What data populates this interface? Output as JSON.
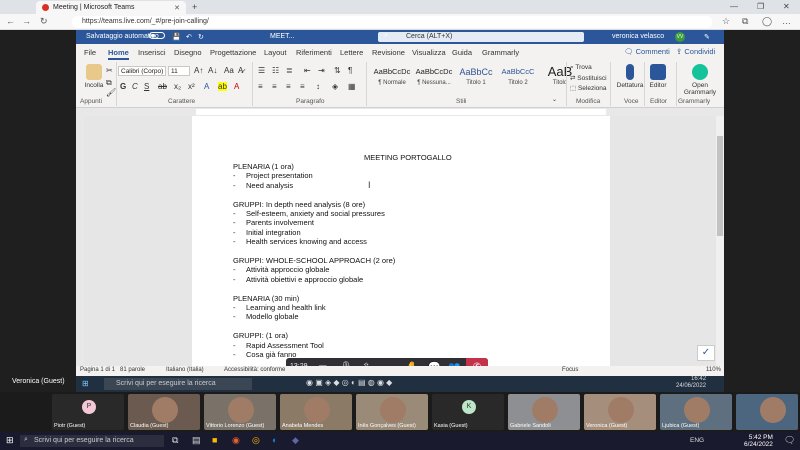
{
  "browser": {
    "tab_title": "Meeting | Microsoft Teams",
    "url": "https://teams.live.com/_#/pre-join-calling/",
    "new_tab": "+"
  },
  "word": {
    "autosave_label": "Salvataggio automatico",
    "doc_title": "MEET...",
    "search_placeholder": "Cerca (ALT+X)",
    "user_name": "veronica velasco",
    "user_initials": "VV",
    "menu_tabs": [
      "File",
      "Home",
      "Inserisci",
      "Disegno",
      "Progettazione",
      "Layout",
      "Riferimenti",
      "Lettere",
      "Revisione",
      "Visualizza",
      "Guida",
      "Grammarly"
    ],
    "active_tab": "Home",
    "comments_label": "Commenti",
    "share_label": "Condividi"
  },
  "ribbon": {
    "paste_label": "Incolla",
    "clipboard_group": "Appunti",
    "font_name": "Calibri (Corpo)",
    "font_size": "11",
    "font_group": "Carattere",
    "paragraph_group": "Paragrafo",
    "styles": [
      {
        "sample": "AaBbCcDc",
        "name": "¶ Normale"
      },
      {
        "sample": "AaBbCcDc",
        "name": "¶ Nessuna..."
      },
      {
        "sample": "AaBbCc",
        "name": "Titolo 1"
      },
      {
        "sample": "AaBbCcC",
        "name": "Titolo 2"
      },
      {
        "sample": "AaB",
        "name": "Titolo"
      }
    ],
    "styles_group": "Stili",
    "find_label": "Trova",
    "replace_label": "Sostituisci",
    "select_label": "Seleziona",
    "edit_group": "Modifica",
    "dictate_label": "Dettatura",
    "voice_group": "Voce",
    "editor_label": "Editor",
    "editor_group": "Editor",
    "grammarly_label": "Open Grammarly",
    "grammarly_group": "Grammarly"
  },
  "document": {
    "title": "MEETING PORTOGALLO",
    "lines": [
      {
        "text": "PLENARIA (1 ora)",
        "bullet": false
      },
      {
        "text": "Project presentation",
        "bullet": true
      },
      {
        "text": "Need analysis",
        "bullet": true
      },
      {
        "text": "",
        "bullet": false
      },
      {
        "text": "GRUPPI: In depth need analysis (8 ore)",
        "bullet": false
      },
      {
        "text": "Self-esteem, anxiety and social pressures",
        "bullet": true
      },
      {
        "text": "Parents involvement",
        "bullet": true
      },
      {
        "text": "Initial integration",
        "bullet": true
      },
      {
        "text": "Health services knowing and access",
        "bullet": true
      },
      {
        "text": "",
        "bullet": false
      },
      {
        "text": "GRUPPI: WHOLE-SCHOOL APPROACH (2 ore)",
        "bullet": false
      },
      {
        "text": "Attività approccio globale",
        "bullet": true
      },
      {
        "text": "Attività obiettivi e approccio globale",
        "bullet": true
      },
      {
        "text": "",
        "bullet": false
      },
      {
        "text": "PLENARIA (30 min)",
        "bullet": false
      },
      {
        "text": "Learning and health link",
        "bullet": true
      },
      {
        "text": "Modello globale",
        "bullet": true
      },
      {
        "text": "",
        "bullet": false
      },
      {
        "text": "GRUPPI: (1 ora)",
        "bullet": false
      },
      {
        "text": "Rapid Assessment Tool",
        "bullet": true
      },
      {
        "text": "Cosa già fanno",
        "bullet": true
      }
    ]
  },
  "status": {
    "page": "Pagina 1 di 1",
    "words": "81 parole",
    "language": "Italiano (Italia)",
    "accessibility": "Accessibilità: conforme",
    "focus": "Focus",
    "zoom": "110%"
  },
  "teams": {
    "timer": "13:29"
  },
  "inner_taskbar": {
    "search": "Scrivi qui per eseguire la ricerca",
    "time": "16:42",
    "date": "24/06/2022"
  },
  "sharer_label": "Veronica (Guest)",
  "participants": [
    {
      "name": "Piotr (Guest)",
      "initial": "P",
      "type": "initial",
      "color": "#f4c7d6"
    },
    {
      "name": "Claudia (Guest)",
      "initial": "",
      "type": "video",
      "color": "#6a5a50"
    },
    {
      "name": "Vittorio Lorenzo (Guest)",
      "initial": "",
      "type": "video",
      "color": "#7a7268"
    },
    {
      "name": "Anabela Mendes",
      "initial": "",
      "type": "video",
      "color": "#8a7a66"
    },
    {
      "name": "Inês Gonçalves (Guest)",
      "initial": "",
      "type": "video",
      "color": "#9a8a78"
    },
    {
      "name": "Kasia (Guest)",
      "initial": "K",
      "type": "initial",
      "color": "#bde5c8"
    },
    {
      "name": "Gabriele Sandoli",
      "initial": "",
      "type": "video",
      "color": "#8d8f92"
    },
    {
      "name": "Veronica (Guest)",
      "initial": "",
      "type": "video",
      "color": "#a68e7c"
    },
    {
      "name": "Ljubica (Guest)",
      "initial": "",
      "type": "video",
      "color": "#5e6f7f"
    },
    {
      "name": "",
      "initial": "",
      "type": "video",
      "color": "#4d6680"
    }
  ],
  "taskbar": {
    "search": "Scrivi qui per eseguire la ricerca",
    "language": "ENG",
    "time": "5:42 PM",
    "date": "6/24/2022"
  }
}
